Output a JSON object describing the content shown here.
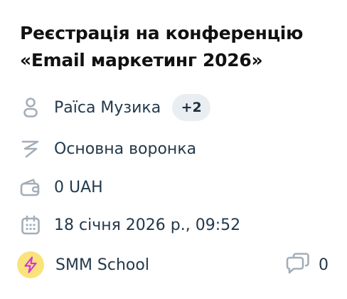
{
  "deal": {
    "title_line1": "Реєстрація на конференцію",
    "title_line2": "«Email маркетинг 2026»"
  },
  "owner": {
    "icon": "person-icon",
    "name": "Раїса Музика",
    "extra_count": "+2"
  },
  "funnel": {
    "icon": "funnel-icon",
    "label": "Основна воронка"
  },
  "amount": {
    "icon": "wallet-icon",
    "label": "0 UAH"
  },
  "date": {
    "icon": "calendar-icon",
    "label": "18 січня 2026 р., 09:52"
  },
  "source": {
    "icon": "lightning-icon",
    "name": "SMM School"
  },
  "comments": {
    "icon": "comments-icon",
    "count": "0"
  },
  "colors": {
    "link": "#1a93c6",
    "icon": "#a3aeb8",
    "badge_bg": "#e9eef2",
    "source_avatar_bg": "#fbe37c",
    "source_icon": "#d13ad6"
  }
}
